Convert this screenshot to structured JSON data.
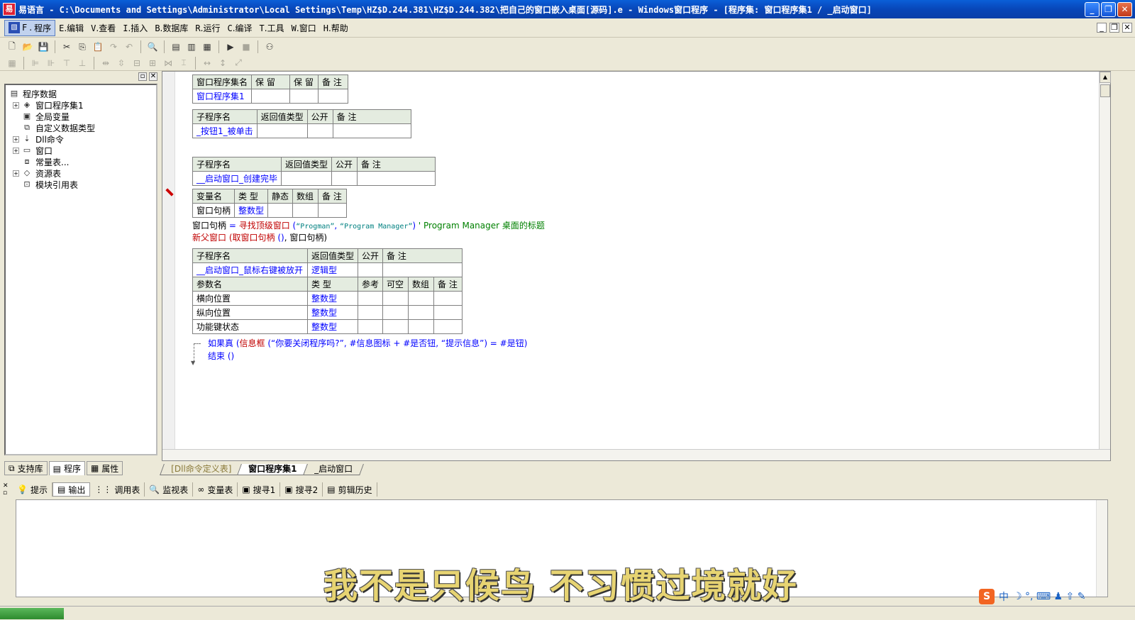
{
  "window": {
    "app_icon": "yi-language-icon",
    "title": "易语言 - C:\\Documents and Settings\\Administrator\\Local Settings\\Temp\\HZ$D.244.381\\HZ$D.244.382\\把自己的窗口嵌入桌面[源码].e - Windows窗口程序 - [程序集: 窗口程序集1 / _启动窗口]",
    "minimize": "_",
    "restore": "❐",
    "close": "✕"
  },
  "menubar": {
    "items": [
      {
        "key": "F",
        "label": "程序"
      },
      {
        "key": "E",
        "label": "编辑"
      },
      {
        "key": "V",
        "label": "查看"
      },
      {
        "key": "I",
        "label": "插入"
      },
      {
        "key": "B",
        "label": "数据库"
      },
      {
        "key": "R",
        "label": "运行"
      },
      {
        "key": "C",
        "label": "编译"
      },
      {
        "key": "T",
        "label": "工具"
      },
      {
        "key": "W",
        "label": "窗口"
      },
      {
        "key": "H",
        "label": "帮助"
      }
    ]
  },
  "tree": {
    "items": [
      {
        "label": "程序数据",
        "icon": "database-icon",
        "level": 0,
        "expander": ""
      },
      {
        "label": "窗口程序集1",
        "icon": "module-icon",
        "level": 1,
        "expander": "+"
      },
      {
        "label": "全局变量",
        "icon": "global-var-icon",
        "level": 1,
        "expander": ""
      },
      {
        "label": "自定义数据类型",
        "icon": "custom-type-icon",
        "level": 1,
        "expander": ""
      },
      {
        "label": "Dll命令",
        "icon": "dll-icon",
        "level": 1,
        "expander": "+"
      },
      {
        "label": "窗口",
        "icon": "window-icon",
        "level": 1,
        "expander": "+"
      },
      {
        "label": "常量表...",
        "icon": "constant-icon",
        "level": 1,
        "expander": ""
      },
      {
        "label": "资源表",
        "icon": "resource-icon",
        "level": 1,
        "expander": "+"
      },
      {
        "label": "模块引用表",
        "icon": "module-ref-icon",
        "level": 1,
        "expander": ""
      }
    ]
  },
  "left_tabs": [
    "支持库",
    "程序",
    "属性"
  ],
  "code": {
    "assembly_table": {
      "headers": [
        "窗口程序集名",
        "保 留",
        "保 留",
        "备 注"
      ],
      "row": [
        "窗口程序集1",
        "",
        "",
        ""
      ]
    },
    "sub1": {
      "headers": [
        "子程序名",
        "返回值类型",
        "公开",
        "备 注"
      ],
      "row": [
        "_按钮1_被单击",
        "",
        "",
        ""
      ]
    },
    "sub2": {
      "headers": [
        "子程序名",
        "返回值类型",
        "公开",
        "备 注"
      ],
      "row": [
        "__启动窗口_创建完毕",
        "",
        "",
        ""
      ]
    },
    "var_table": {
      "headers": [
        "变量名",
        "类 型",
        "静态",
        "数组",
        "备 注"
      ],
      "row": [
        "窗口句柄",
        "整数型",
        "",
        "",
        ""
      ]
    },
    "line1": {
      "target": "窗口句柄",
      "op": " = ",
      "func": "寻找顶级窗口",
      "args_open": " (",
      "arg1": "“Progman”",
      "comma": ", ",
      "arg2": "“Program Manager”",
      "args_close": ") ",
      "comment": " ' Program Manager 桌面的标题"
    },
    "line2": {
      "func": "新父窗口",
      "open": " (",
      "inner": "取窗口句柄",
      "inner_args": " ()",
      "rest": ", 窗口句柄)"
    },
    "sub3": {
      "headers": [
        "子程序名",
        "返回值类型",
        "公开",
        "备 注"
      ],
      "row": [
        "__启动窗口_鼠标右键被放开",
        "逻辑型",
        "",
        ""
      ],
      "param_headers": [
        "参数名",
        "类 型",
        "参考",
        "可空",
        "数组",
        "备 注"
      ],
      "params": [
        [
          "横向位置",
          "整数型",
          "",
          "",
          "",
          ""
        ],
        [
          "纵向位置",
          "整数型",
          "",
          "",
          "",
          ""
        ],
        [
          "功能键状态",
          "整数型",
          "",
          "",
          "",
          ""
        ]
      ]
    },
    "line3": {
      "keyword": "如果真",
      "open": " (",
      "func": "信息框",
      "args": " (“你要关闭程序吗?”, #信息图标 + #是否钮, “提示信息”) = #是钮",
      "close": ")"
    },
    "line4": {
      "keyword": "结束",
      "args": " ()"
    }
  },
  "doc_tabs": [
    "[Dll命令定义表]",
    "窗口程序集1",
    "_启动窗口"
  ],
  "output_tabs": [
    {
      "label": "提示",
      "icon": "hint-icon"
    },
    {
      "label": "输出",
      "icon": "output-icon"
    },
    {
      "label": "调用表",
      "icon": "call-stack-icon"
    },
    {
      "label": "监视表",
      "icon": "watch-icon"
    },
    {
      "label": "变量表",
      "icon": "variables-icon"
    },
    {
      "label": "搜寻1",
      "icon": "search1-icon"
    },
    {
      "label": "搜寻2",
      "icon": "search2-icon"
    },
    {
      "label": "剪辑历史",
      "icon": "clip-history-icon"
    }
  ],
  "caption": "我不是只候鸟 不习惯过境就好",
  "ime": {
    "logo": "S",
    "mode": "中",
    "icons": "☽ °, ⌨ ♟ ⇧ ✎"
  }
}
